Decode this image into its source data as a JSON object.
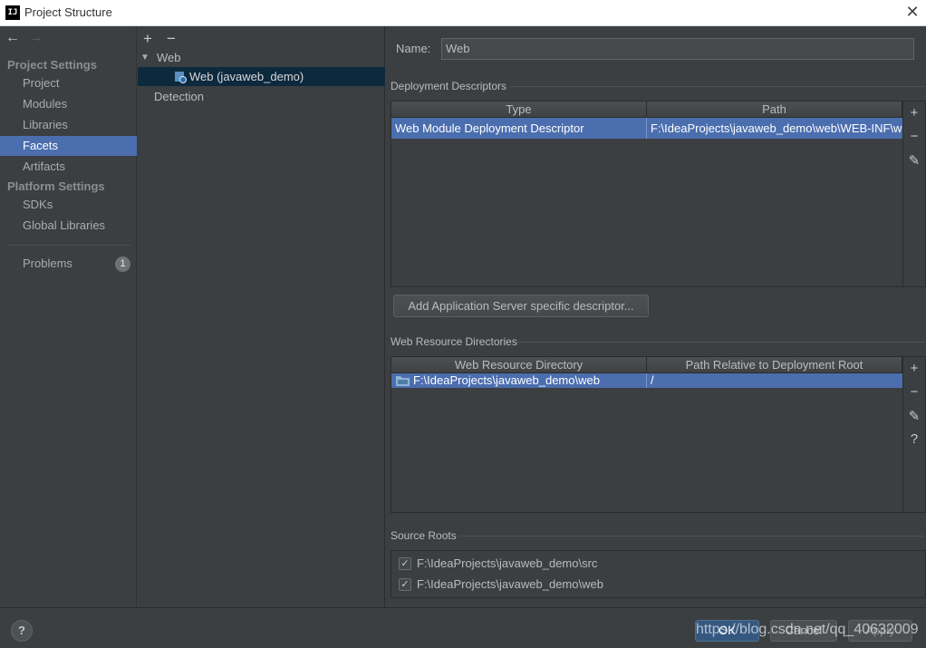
{
  "window": {
    "title": "Project Structure",
    "logo": "IJ"
  },
  "nav": {
    "project_settings_header": "Project Settings",
    "project_settings_items": [
      "Project",
      "Modules",
      "Libraries",
      "Facets",
      "Artifacts"
    ],
    "platform_settings_header": "Platform Settings",
    "platform_settings_items": [
      "SDKs",
      "Global Libraries"
    ],
    "problems_label": "Problems",
    "problems_count": "1",
    "selected": "Facets"
  },
  "tree": {
    "add": "+",
    "remove": "−",
    "web_group": "Web",
    "facet_item": "Web (javaweb_demo)",
    "detection": "Detection"
  },
  "facet": {
    "name_label": "Name:",
    "name_value": "Web",
    "deployment_descriptors": {
      "title": "Deployment Descriptors",
      "columns": [
        "Type",
        "Path"
      ],
      "rows": [
        {
          "type": "Web Module Deployment Descriptor",
          "path": "F:\\IdeaProjects\\javaweb_demo\\web\\WEB-INF\\web.xml"
        }
      ]
    },
    "add_server_button": "Add Application Server specific descriptor...",
    "web_resource_directories": {
      "title": "Web Resource Directories",
      "columns": [
        "Web Resource Directory",
        "Path Relative to Deployment Root"
      ],
      "rows": [
        {
          "directory": "F:\\IdeaProjects\\javaweb_demo\\web",
          "relative": "/"
        }
      ]
    },
    "source_roots": {
      "title": "Source Roots",
      "items": [
        {
          "path": "F:\\IdeaProjects\\javaweb_demo\\src",
          "checked": true
        },
        {
          "path": "F:\\IdeaProjects\\javaweb_demo\\web",
          "checked": true
        }
      ]
    }
  },
  "footer": {
    "help": "?",
    "ok": "OK",
    "cancel": "Cancel",
    "apply": "Apply",
    "watermark": "https://blog.csdn.net/qq_40632009"
  },
  "icons": {
    "back": "arrow-left-icon",
    "forward": "arrow-right-icon",
    "add": "plus-icon",
    "remove": "minus-icon",
    "edit": "pencil-icon",
    "help": "question-icon"
  },
  "colors": {
    "selection": "#4b6eaf",
    "tree_selection": "#0d293e",
    "background": "#3c3f41"
  }
}
